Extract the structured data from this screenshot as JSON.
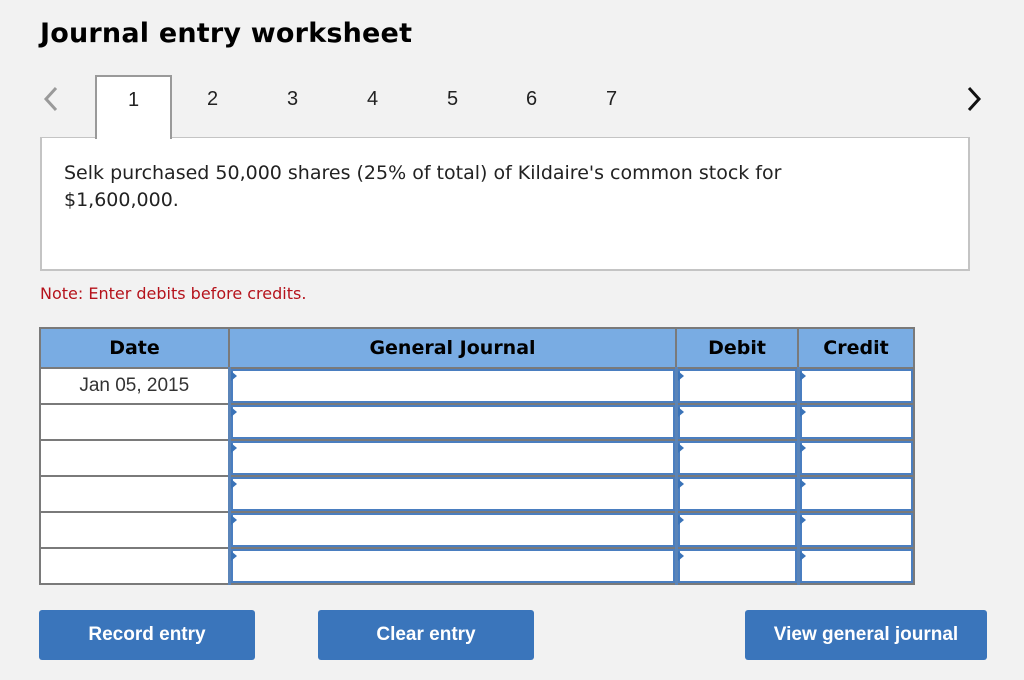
{
  "header": {
    "title": "Journal entry worksheet"
  },
  "navigation": {
    "prev_icon": "chevron-left-icon",
    "next_icon": "chevron-right-icon",
    "tabs": [
      {
        "label": "1",
        "active": true
      },
      {
        "label": "2",
        "active": false
      },
      {
        "label": "3",
        "active": false
      },
      {
        "label": "4",
        "active": false
      },
      {
        "label": "5",
        "active": false
      },
      {
        "label": "6",
        "active": false
      },
      {
        "label": "7",
        "active": false
      }
    ]
  },
  "prompt": {
    "text": "Selk purchased 50,000 shares (25% of total) of Kildaire's common stock for $1,600,000."
  },
  "note": {
    "text": "Note: Enter debits before credits."
  },
  "journal": {
    "columns": [
      "Date",
      "General Journal",
      "Debit",
      "Credit"
    ],
    "rows": [
      {
        "date": "Jan 05, 2015",
        "account": "",
        "debit": "",
        "credit": ""
      },
      {
        "date": "",
        "account": "",
        "debit": "",
        "credit": ""
      },
      {
        "date": "",
        "account": "",
        "debit": "",
        "credit": ""
      },
      {
        "date": "",
        "account": "",
        "debit": "",
        "credit": ""
      },
      {
        "date": "",
        "account": "",
        "debit": "",
        "credit": ""
      },
      {
        "date": "",
        "account": "",
        "debit": "",
        "credit": ""
      }
    ]
  },
  "buttons": {
    "record": "Record entry",
    "clear": "Clear entry",
    "view": "View general journal"
  },
  "colors": {
    "header_bg": "#79ace3",
    "button_bg": "#3a75bb",
    "note_text": "#b5121b"
  }
}
